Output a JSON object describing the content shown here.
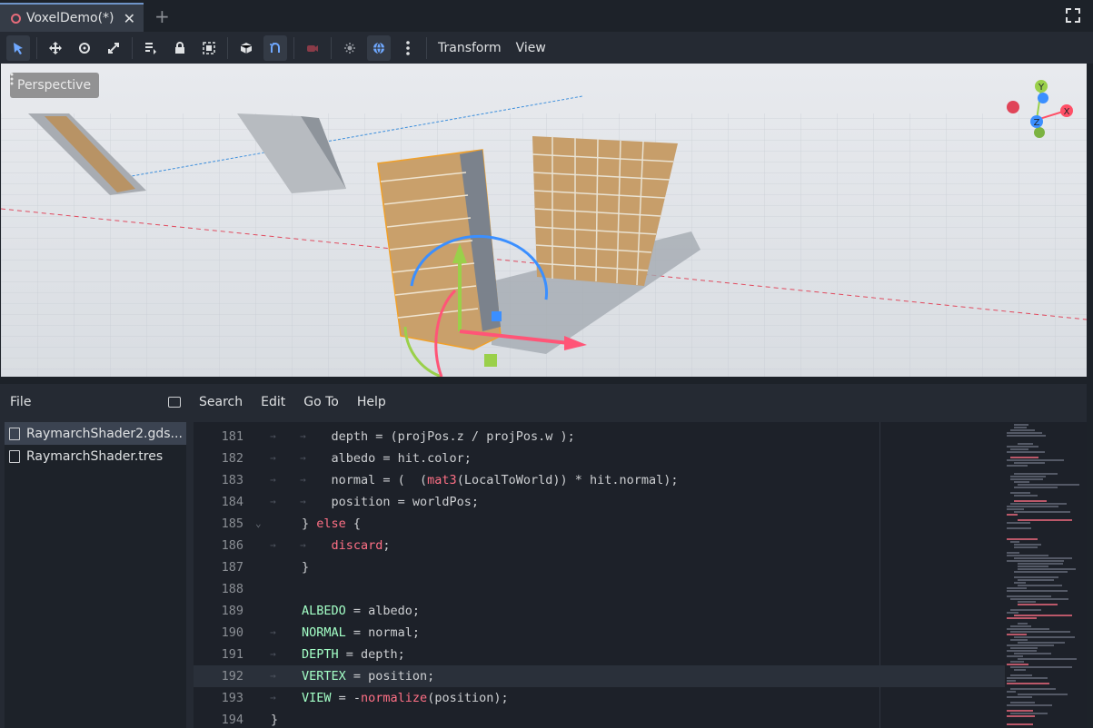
{
  "tab": {
    "title": "VoxelDemo(*)",
    "close": "✕"
  },
  "new_tab": "+",
  "toolbar": {
    "transform_menu": "Transform",
    "view_menu": "View"
  },
  "viewport": {
    "label": "Perspective",
    "axes": {
      "x": "X",
      "y": "Y",
      "z": "Z"
    }
  },
  "script_panel": {
    "file_menu": "File",
    "menus": [
      "Search",
      "Edit",
      "Go To",
      "Help"
    ],
    "files": [
      "RaymarchShader2.gds...",
      "RaymarchShader.tres"
    ]
  },
  "editor": {
    "current_line": "192",
    "lines": [
      {
        "n": "181",
        "code": "    depth = (projPos.z / projPos.w );"
      },
      {
        "n": "182",
        "code": "    albedo = hit.color;"
      },
      {
        "n": "183",
        "code": "    normal = (  (mat3(LocalToWorld)) * hit.normal);"
      },
      {
        "n": "184",
        "code": "    position = worldPos;"
      },
      {
        "n": "185",
        "code": "} else {"
      },
      {
        "n": "186",
        "code": "    discard;"
      },
      {
        "n": "187",
        "code": "}"
      },
      {
        "n": "188",
        "code": ""
      },
      {
        "n": "189",
        "code": "ALBEDO = albedo;"
      },
      {
        "n": "190",
        "code": "NORMAL = normal;"
      },
      {
        "n": "191",
        "code": "DEPTH = depth;"
      },
      {
        "n": "192",
        "code": "VERTEX = position;"
      },
      {
        "n": "193",
        "code": "VIEW = -normalize(position);"
      },
      {
        "n": "194",
        "code": "}"
      }
    ]
  }
}
